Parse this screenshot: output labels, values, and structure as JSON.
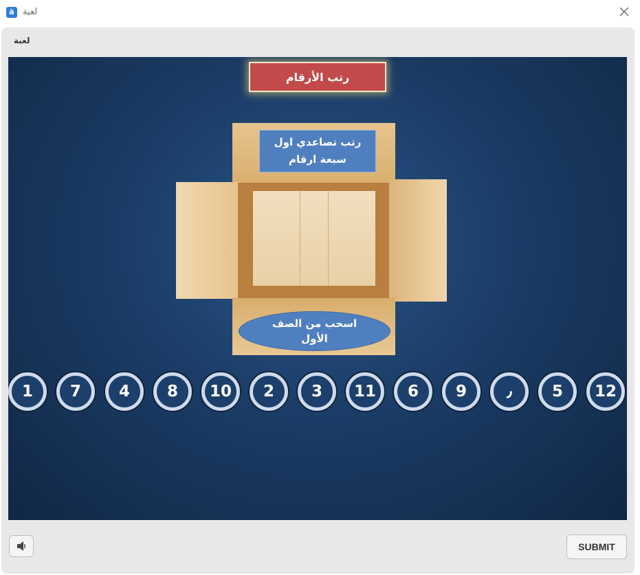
{
  "window": {
    "title": "لعبة",
    "app_icon": "ā"
  },
  "panel": {
    "label": "لعبة"
  },
  "game": {
    "banner": "رتب الأرقام",
    "instruction": "رتب تصاعدي اول\nسبعة ارقام",
    "drag_hint": "اسحب من الصف\nالأول",
    "tokens": [
      "1",
      "7",
      "4",
      "8",
      "10",
      "2",
      "3",
      "11",
      "6",
      "9",
      "٫",
      "5",
      "12"
    ]
  },
  "footer": {
    "submit_label": "SUBMIT"
  },
  "colors": {
    "banner": "#c24a4a",
    "instruction_bg": "#4f7fbf",
    "stage_bg": "#1b3c66"
  }
}
